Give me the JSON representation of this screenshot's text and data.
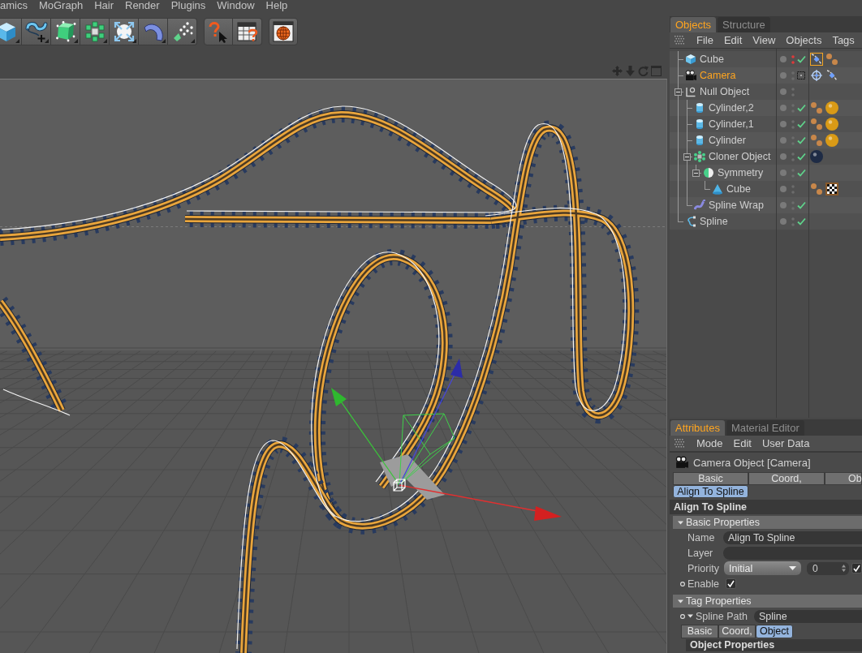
{
  "menu_bar": {
    "items": [
      "amics",
      "MoGraph",
      "Hair",
      "Render",
      "Plugins",
      "Window",
      "Help"
    ]
  },
  "toolbar": {
    "groups": [
      [
        {
          "kind": "cube",
          "foldout": true
        },
        {
          "kind": "spline-pen",
          "foldout": true
        },
        {
          "kind": "subdivision",
          "foldout": true
        },
        {
          "kind": "cloner",
          "foldout": true
        },
        {
          "kind": "deformer",
          "foldout": true
        },
        {
          "kind": "bend",
          "foldout": true
        },
        {
          "kind": "particles",
          "foldout": true
        }
      ],
      [
        {
          "kind": "help",
          "foldout": false
        },
        {
          "kind": "render-settings",
          "foldout": false
        }
      ],
      [
        {
          "kind": "render-view",
          "foldout": false
        }
      ]
    ]
  },
  "viewport": {
    "header_icons": [
      {
        "kind": "move"
      },
      {
        "kind": "scroll"
      },
      {
        "kind": "rotate"
      },
      {
        "kind": "maximize"
      }
    ]
  },
  "objects_panel": {
    "tabs": [
      {
        "label": "Objects",
        "selected": true
      },
      {
        "label": "Structure",
        "selected": false
      }
    ],
    "menu": [
      "File",
      "Edit",
      "View",
      "Objects",
      "Tags"
    ],
    "objects": [
      {
        "name": "Cube",
        "kind": "cube",
        "selected": false,
        "hidden": true,
        "toggle": {
          "kind": "check"
        },
        "tags": [
          {
            "kind": "align",
            "selected": true
          },
          {
            "kind": "phong",
            "selected": false
          }
        ]
      },
      {
        "name": "Camera",
        "kind": "camera",
        "selected": true,
        "hidden": false,
        "toggle": {
          "kind": "frame"
        },
        "tags": [
          {
            "kind": "target",
            "selected": false
          },
          {
            "kind": "align",
            "selected": false
          }
        ]
      },
      {
        "name": "Null Object",
        "kind": "null",
        "selected": false,
        "hidden": false,
        "expanded": true,
        "children": [
          {
            "name": "Cylinder,2",
            "kind": "cylinder",
            "selected": false,
            "hidden": false,
            "toggle": {
              "kind": "check"
            },
            "tags": [
              {
                "kind": "phong",
                "selected": false
              },
              {
                "kind": "material",
                "color": "#d99a16",
                "selected": false
              }
            ]
          },
          {
            "name": "Cylinder,1",
            "kind": "cylinder",
            "selected": false,
            "hidden": false,
            "toggle": {
              "kind": "check"
            },
            "tags": [
              {
                "kind": "phong",
                "selected": false
              },
              {
                "kind": "material",
                "color": "#d99a16",
                "selected": false
              }
            ]
          },
          {
            "name": "Cylinder",
            "kind": "cylinder",
            "selected": false,
            "hidden": false,
            "toggle": {
              "kind": "check"
            },
            "tags": [
              {
                "kind": "phong",
                "selected": false
              },
              {
                "kind": "material",
                "color": "#d99a16",
                "selected": false
              }
            ]
          },
          {
            "name": "Cloner Object",
            "kind": "cloner",
            "selected": false,
            "hidden": false,
            "toggle": {
              "kind": "check"
            },
            "expanded": true,
            "tags": [
              {
                "kind": "material",
                "color": "#1e2b45",
                "selected": false
              }
            ],
            "children": [
              {
                "name": "Symmetry",
                "kind": "symmetry",
                "selected": false,
                "hidden": false,
                "toggle": {
                  "kind": "check"
                },
                "expanded": true,
                "children": [
                  {
                    "name": "Cube",
                    "kind": "cone",
                    "selected": false,
                    "hidden": false,
                    "tags": [
                      {
                        "kind": "phong",
                        "selected": false
                      },
                      {
                        "kind": "checker",
                        "selected": false
                      }
                    ]
                  }
                ]
              }
            ]
          },
          {
            "name": "Spline Wrap",
            "kind": "spline-wrap",
            "selected": false,
            "hidden": false,
            "toggle": {
              "kind": "check"
            }
          }
        ]
      },
      {
        "name": "Spline",
        "kind": "spline",
        "selected": false,
        "hidden": false,
        "toggle": {
          "kind": "check"
        }
      }
    ]
  },
  "attributes_panel": {
    "tabs": [
      {
        "label": "Attributes",
        "selected": true
      },
      {
        "label": "Material Editor",
        "selected": false
      }
    ],
    "menu": [
      "Mode",
      "Edit",
      "User Data"
    ],
    "object": {
      "kind": "camera",
      "title": "Camera Object [Camera]"
    },
    "page_tabs": [
      {
        "label": "Basic",
        "selected": false
      },
      {
        "label": "Coord,",
        "selected": false
      },
      {
        "label": "Ob",
        "selected": false
      },
      {
        "label": "Align To Spline",
        "selected": true
      }
    ],
    "section": "Align To Spline",
    "groups": [
      {
        "title": "Basic Properties",
        "expanded": true,
        "fields": [
          {
            "kind": "text",
            "label": "Name",
            "value": "Align To Spline"
          },
          {
            "kind": "text",
            "label": "Layer"
          },
          {
            "kind": "priority",
            "label": "Priority",
            "value": "Initial",
            "number": "0",
            "checked": true
          },
          {
            "kind": "checkbox",
            "label": "Enable",
            "checked": true,
            "keyframe": true
          }
        ]
      },
      {
        "title": "Tag Properties",
        "expanded": true,
        "fields": [
          {
            "kind": "link",
            "label": "Spline Path",
            "value": "Spline",
            "keyframe": true,
            "expanded": true,
            "tabs": [
              {
                "label": "Basic",
                "selected": false
              },
              {
                "label": "Coord,",
                "selected": false
              },
              {
                "label": "Object",
                "selected": true
              }
            ],
            "subsection": "Object Properties"
          }
        ]
      }
    ]
  }
}
